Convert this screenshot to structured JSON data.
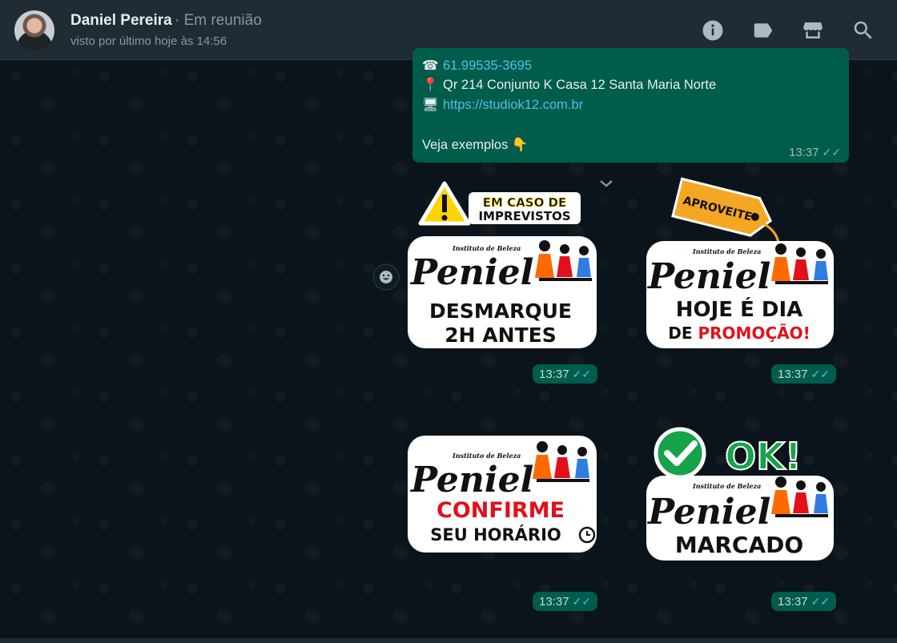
{
  "header": {
    "contact_name": "Daniel Pereira",
    "contact_status": "· Em reunião",
    "last_seen": "visto por último hoje às 14:56",
    "icons": [
      "info-icon",
      "label-icon",
      "store-icon",
      "search-icon"
    ]
  },
  "message": {
    "phone": "61.99535-3695",
    "address": "Qr 214 Conjunto K Casa 12 Santa Maria Norte",
    "website": "https://studiok12.com.br",
    "footer_text": "Veja exemplos",
    "pointing_emoji": "👇",
    "pin_emoji": "📍",
    "phone_emoji": "☎",
    "computer_emoji": "🖥",
    "time": "13:37",
    "ticks": "✓✓"
  },
  "stickers": [
    {
      "id": "desmarque",
      "badge_line1": "EM CASO DE",
      "badge_line2": "IMPREVISTOS",
      "brand_small": "Instituto de Beleza",
      "brand": "Peniel",
      "line1": "DESMARQUE",
      "line2": "2H ANTES",
      "time": "13:37",
      "ticks": "✓✓"
    },
    {
      "id": "promocao",
      "tag": "APROVEITE",
      "brand_small": "Instituto de Beleza",
      "brand": "Peniel",
      "line1": "HOJE É DIA",
      "line2a": "DE ",
      "line2b": "PROMOÇÃO!",
      "time": "13:37",
      "ticks": "✓✓"
    },
    {
      "id": "confirme",
      "brand_small": "Instituto de Beleza",
      "brand": "Peniel",
      "line1": "CONFIRME",
      "line2": "SEU HORÁRIO",
      "time": "13:37",
      "ticks": "✓✓"
    },
    {
      "id": "ok-marcado",
      "ok_text": "OK!",
      "brand_small": "Instituto de Beleza",
      "brand": "Peniel",
      "line1": "MARCADO",
      "time": "13:37",
      "ticks": "✓✓"
    }
  ],
  "colors": {
    "header_bg": "#202c33",
    "chat_bg": "#0b141a",
    "outgoing_bubble": "#005c4b",
    "link": "#53bdeb",
    "read_ticks": "#53bdeb",
    "promo_red": "#e3101b",
    "ok_green": "#16a34a",
    "tag_orange": "#f5a623"
  }
}
